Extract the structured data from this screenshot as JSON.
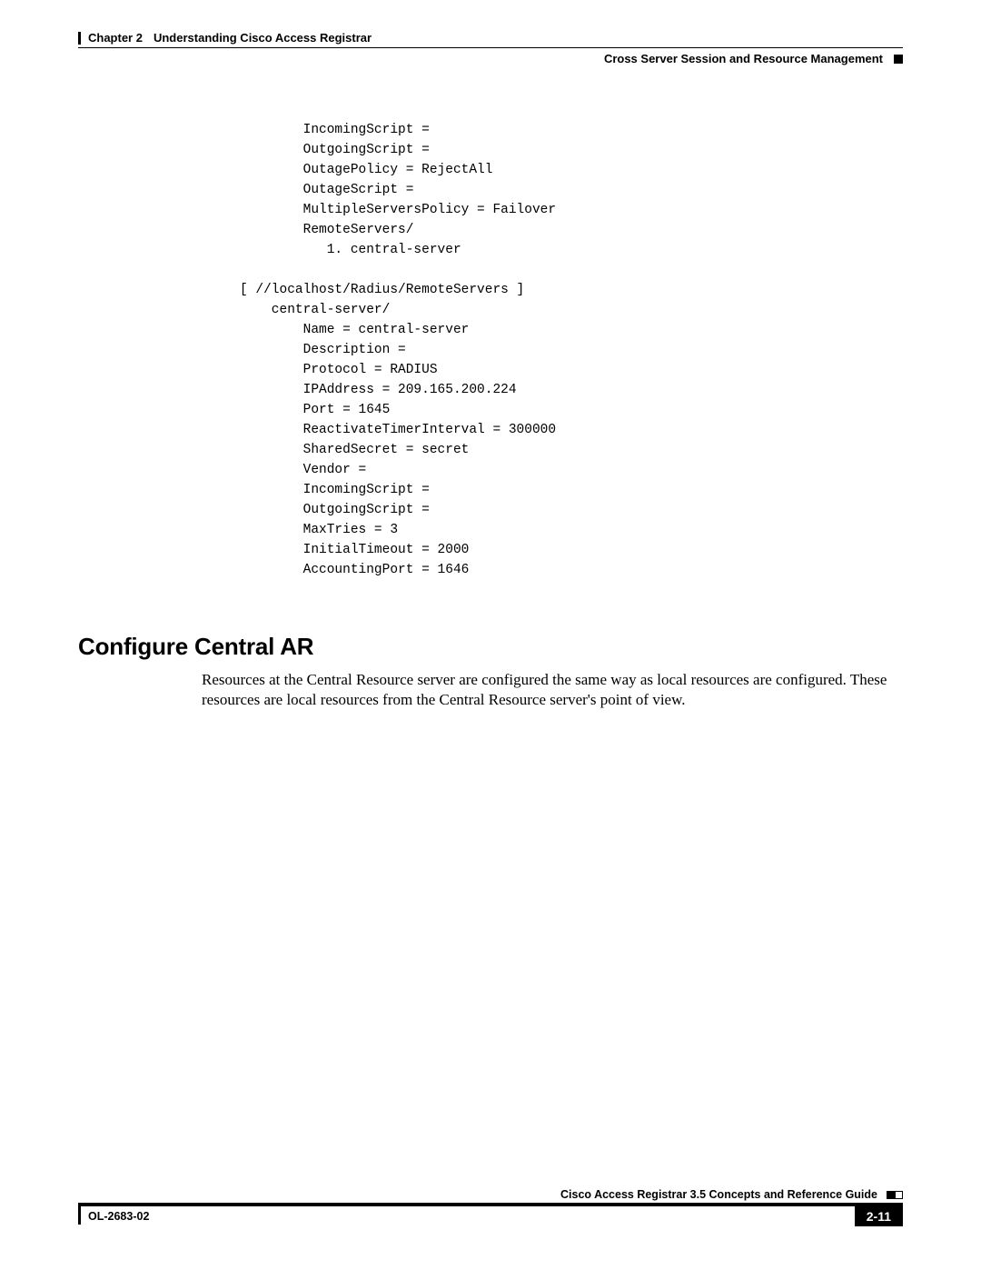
{
  "header": {
    "chapter_num": "Chapter 2",
    "chapter_name": "Understanding Cisco Access Registrar",
    "section_title": "Cross Server Session and Resource Management"
  },
  "code": "        IncomingScript = \n        OutgoingScript = \n        OutagePolicy = RejectAll\n        OutageScript = \n        MultipleServersPolicy = Failover\n        RemoteServers/\n           1. central-server\n\n[ //localhost/Radius/RemoteServers ]\n    central-server/\n        Name = central-server\n        Description = \n        Protocol = RADIUS\n        IPAddress = 209.165.200.224\n        Port = 1645\n        ReactivateTimerInterval = 300000\n        SharedSecret = secret\n        Vendor = \n        IncomingScript = \n        OutgoingScript = \n        MaxTries = 3\n        InitialTimeout = 2000\n        AccountingPort = 1646",
  "section_heading": "Configure Central AR",
  "body": "Resources at the Central Resource server are configured the same way as local resources are configured. These resources are local resources from the Central Resource server's point of view.",
  "footer": {
    "guide_title": "Cisco Access Registrar 3.5 Concepts and Reference Guide",
    "doc_id": "OL-2683-02",
    "page_number": "2-11"
  }
}
